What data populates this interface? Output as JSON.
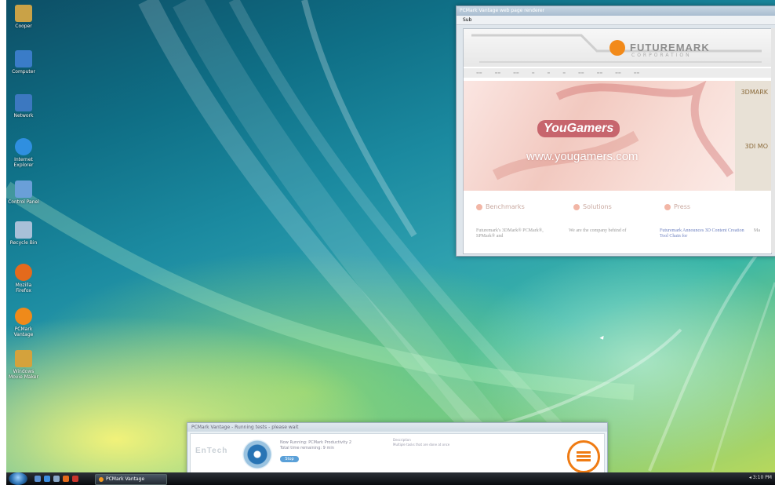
{
  "desktop_icons": [
    {
      "name": "user-folder-icon",
      "label": "Cooper",
      "color": "#c9a247"
    },
    {
      "name": "computer-icon",
      "label": "Computer",
      "color": "#3a7cc8"
    },
    {
      "name": "network-icon",
      "label": "Network",
      "color": "#3c78c0"
    },
    {
      "name": "internet-explorer-icon",
      "label": "Internet Explorer",
      "color": "#2f8fe0"
    },
    {
      "name": "control-panel-icon",
      "label": "Control Panel",
      "color": "#6a9fd8"
    },
    {
      "name": "recycle-bin-icon",
      "label": "Recycle Bin",
      "color": "#a8c0d8"
    },
    {
      "name": "firefox-icon",
      "label": "Mozilla Firefox",
      "color": "#e46a1c"
    },
    {
      "name": "pcmark-icon",
      "label": "PCMark Vantage",
      "color": "#ef8a1a"
    },
    {
      "name": "movie-maker-icon",
      "label": "Windows Movie Maker",
      "color": "#d4a23c"
    }
  ],
  "browser": {
    "title": "PCMark Vantage web page renderer",
    "menu_label": "Sub",
    "futuremark_logo": "FUTUREMARK",
    "futuremark_sub": "CORPORATION",
    "yougamers_logo": "YouGamers",
    "yougamers_url": "www.yougamers.com",
    "sections": [
      "Benchmarks",
      "Solutions",
      "Press"
    ],
    "side_ad_1": "3DMARK",
    "side_ad_2": "3DI MO",
    "col1": "Futuremark's 3DMark® PCMark®, SPMark® and",
    "col2": "We are the company behind of",
    "col3": "Futuremark Announces 3D Content Creation Tool Chain for",
    "col4": "Ma"
  },
  "pcmark_dialog": {
    "title": "PCMark Vantage - Running tests - please wait",
    "entech": "EnTech",
    "now_running": "Now Running:  PCMark Productivity 2",
    "time_remaining": "Total time remaining:   9 min",
    "stop_label": "Stop",
    "description_title": "Description",
    "description": "Multiple tasks that are done at once"
  },
  "taskbar": {
    "task_label": "PCMark Vantage",
    "tray_text": "◂ 3:10 PM"
  }
}
